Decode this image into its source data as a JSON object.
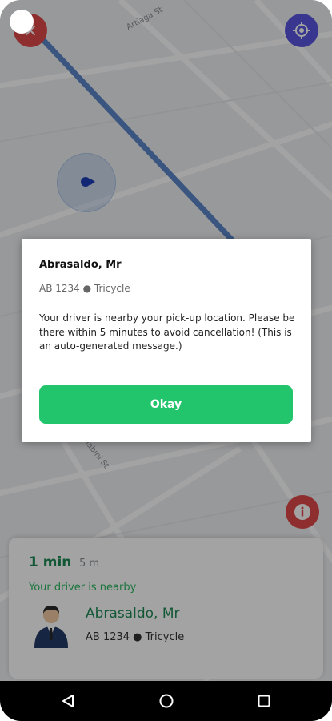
{
  "map": {
    "street_labels": [
      "Artiaga St",
      "Mabini St"
    ],
    "colors": {
      "road": "#5a85c8",
      "close": "#e04848",
      "locate": "#5855e0",
      "info": "#e04848"
    }
  },
  "controls": {
    "close_icon": "close-icon",
    "locate_icon": "target-icon",
    "info_icon": "info-icon",
    "info_glyph": "i",
    "close_glyph": "×"
  },
  "sheet": {
    "eta": "1 min",
    "distance": "5 m",
    "status": "Your driver is nearby",
    "driver_name": "Abrasaldo, Mr",
    "vehicle": "AB 1234 ● Tricycle"
  },
  "dialog": {
    "title": "Abrasaldo, Mr",
    "subtitle": "AB 1234 ● Tricycle",
    "message": "Your driver is nearby your pick-up location. Please be there within 5 minutes to avoid cancellation! (This is an auto-generated message.)",
    "button": "Okay",
    "button_color": "#22c56b"
  },
  "navbar": {
    "back_icon": "back-triangle-icon",
    "home_icon": "home-circle-icon",
    "recent_icon": "recents-square-icon"
  }
}
